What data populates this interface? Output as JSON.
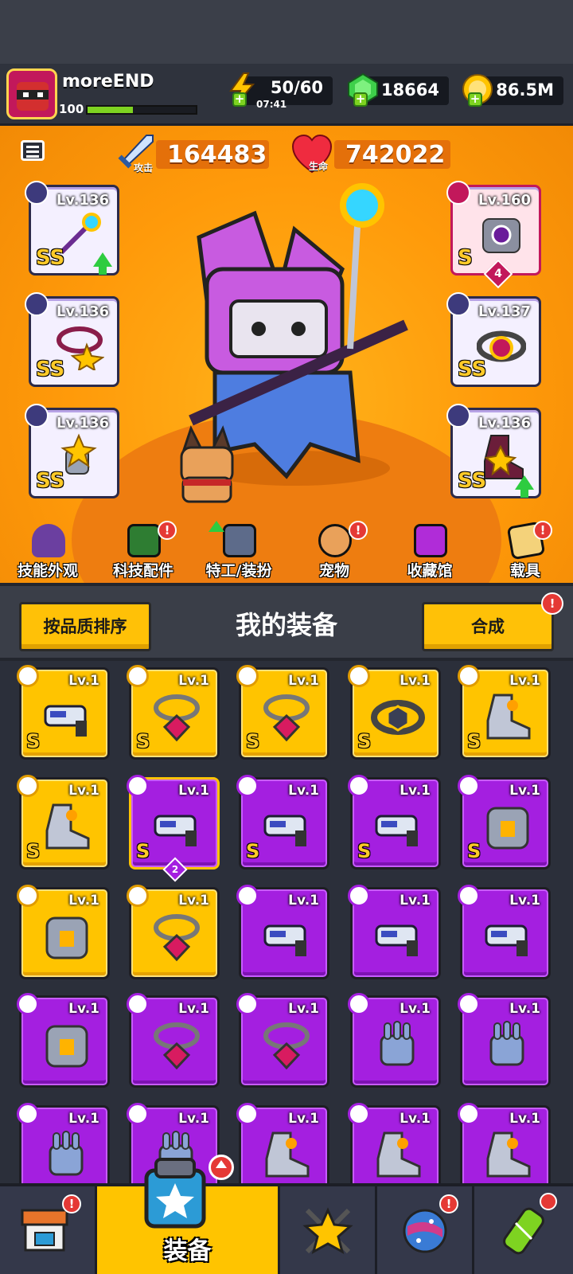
{
  "player": {
    "name": "moreEND",
    "level": "100",
    "xp_fraction": 0.42
  },
  "resources": {
    "energy": {
      "value": "50/60",
      "timer": "07:41"
    },
    "gems": {
      "value": "18664"
    },
    "gold": {
      "value": "86.5M"
    }
  },
  "stats": {
    "attack": {
      "value": "164483",
      "label": "攻击"
    },
    "health": {
      "value": "742022",
      "label": "生命"
    }
  },
  "equipped": {
    "left": [
      {
        "level": "Lv.136",
        "rank": "SS",
        "icon": "weapon-icon",
        "upgradable": true
      },
      {
        "level": "Lv.136",
        "rank": "SS",
        "icon": "necklace-icon",
        "upgradable": false
      },
      {
        "level": "Lv.136",
        "rank": "SS",
        "icon": "glove-icon",
        "upgradable": false
      }
    ],
    "right": [
      {
        "level": "Lv.160",
        "rank": "S",
        "icon": "armor-icon",
        "stars": "4",
        "upgradable": false
      },
      {
        "level": "Lv.137",
        "rank": "SS",
        "icon": "belt-icon",
        "upgradable": false
      },
      {
        "level": "Lv.136",
        "rank": "SS",
        "icon": "boots-icon",
        "upgradable": true
      }
    ]
  },
  "hero_nav": [
    {
      "label": "技能外观",
      "alert": false
    },
    {
      "label": "科技配件",
      "alert": true
    },
    {
      "label": "特工/装扮",
      "alert": false
    },
    {
      "label": "宠物",
      "alert": true
    },
    {
      "label": "收藏馆",
      "alert": false
    },
    {
      "label": "载具",
      "alert": true
    }
  ],
  "inventory": {
    "sort_button": "按品质排序",
    "title": "我的装备",
    "merge_button": "合成",
    "items": [
      {
        "lv": "Lv.1",
        "tier": "gold",
        "rank": "S",
        "icon": "weapon-icon"
      },
      {
        "lv": "Lv.1",
        "tier": "gold",
        "rank": "S",
        "icon": "necklace-icon"
      },
      {
        "lv": "Lv.1",
        "tier": "gold",
        "rank": "S",
        "icon": "necklace-icon"
      },
      {
        "lv": "Lv.1",
        "tier": "gold",
        "rank": "S",
        "icon": "belt-icon"
      },
      {
        "lv": "Lv.1",
        "tier": "gold",
        "rank": "S",
        "icon": "boots-icon"
      },
      {
        "lv": "Lv.1",
        "tier": "gold",
        "rank": "S",
        "icon": "boots-icon"
      },
      {
        "lv": "Lv.1",
        "tier": "purple",
        "rank": "S",
        "icon": "weapon-icon",
        "count": "2",
        "selected": true
      },
      {
        "lv": "Lv.1",
        "tier": "purple",
        "rank": "S",
        "icon": "weapon-icon"
      },
      {
        "lv": "Lv.1",
        "tier": "purple",
        "rank": "S",
        "icon": "weapon-icon"
      },
      {
        "lv": "Lv.1",
        "tier": "purple",
        "rank": "S",
        "icon": "armor-icon"
      },
      {
        "lv": "Lv.1",
        "tier": "gold",
        "rank": "",
        "icon": "armor-icon"
      },
      {
        "lv": "Lv.1",
        "tier": "gold",
        "rank": "",
        "icon": "necklace-icon"
      },
      {
        "lv": "Lv.1",
        "tier": "purple",
        "rank": "",
        "icon": "weapon-icon"
      },
      {
        "lv": "Lv.1",
        "tier": "purple",
        "rank": "",
        "icon": "weapon-icon"
      },
      {
        "lv": "Lv.1",
        "tier": "purple",
        "rank": "",
        "icon": "weapon-icon"
      },
      {
        "lv": "Lv.1",
        "tier": "purple",
        "rank": "",
        "icon": "armor-icon"
      },
      {
        "lv": "Lv.1",
        "tier": "purple",
        "rank": "",
        "icon": "necklace-icon"
      },
      {
        "lv": "Lv.1",
        "tier": "purple",
        "rank": "",
        "icon": "necklace-icon"
      },
      {
        "lv": "Lv.1",
        "tier": "purple",
        "rank": "",
        "icon": "glove-icon"
      },
      {
        "lv": "Lv.1",
        "tier": "purple",
        "rank": "",
        "icon": "glove-icon"
      },
      {
        "lv": "Lv.1",
        "tier": "purple",
        "rank": "",
        "icon": "glove-icon"
      },
      {
        "lv": "Lv.1",
        "tier": "purple",
        "rank": "",
        "icon": "glove-icon"
      },
      {
        "lv": "Lv.1",
        "tier": "purple",
        "rank": "",
        "icon": "boots-icon"
      },
      {
        "lv": "Lv.1",
        "tier": "purple",
        "rank": "",
        "icon": "boots-icon"
      },
      {
        "lv": "Lv.1",
        "tier": "purple",
        "rank": "",
        "icon": "boots-icon"
      }
    ]
  },
  "bottom_nav": [
    {
      "icon": "shop-icon",
      "label": "",
      "alert": true
    },
    {
      "icon": "equipment-icon",
      "label": "装备",
      "active": true,
      "upgrade": true
    },
    {
      "icon": "battle-icon",
      "label": "",
      "alert": false
    },
    {
      "icon": "planet-icon",
      "label": "",
      "alert": true
    },
    {
      "icon": "dna-icon",
      "label": "",
      "alert": false
    }
  ],
  "colors": {
    "accent": "#ffc400",
    "hero_bg": "#ff9a0a",
    "epic": "#a41fe0",
    "alert": "#e53935"
  }
}
